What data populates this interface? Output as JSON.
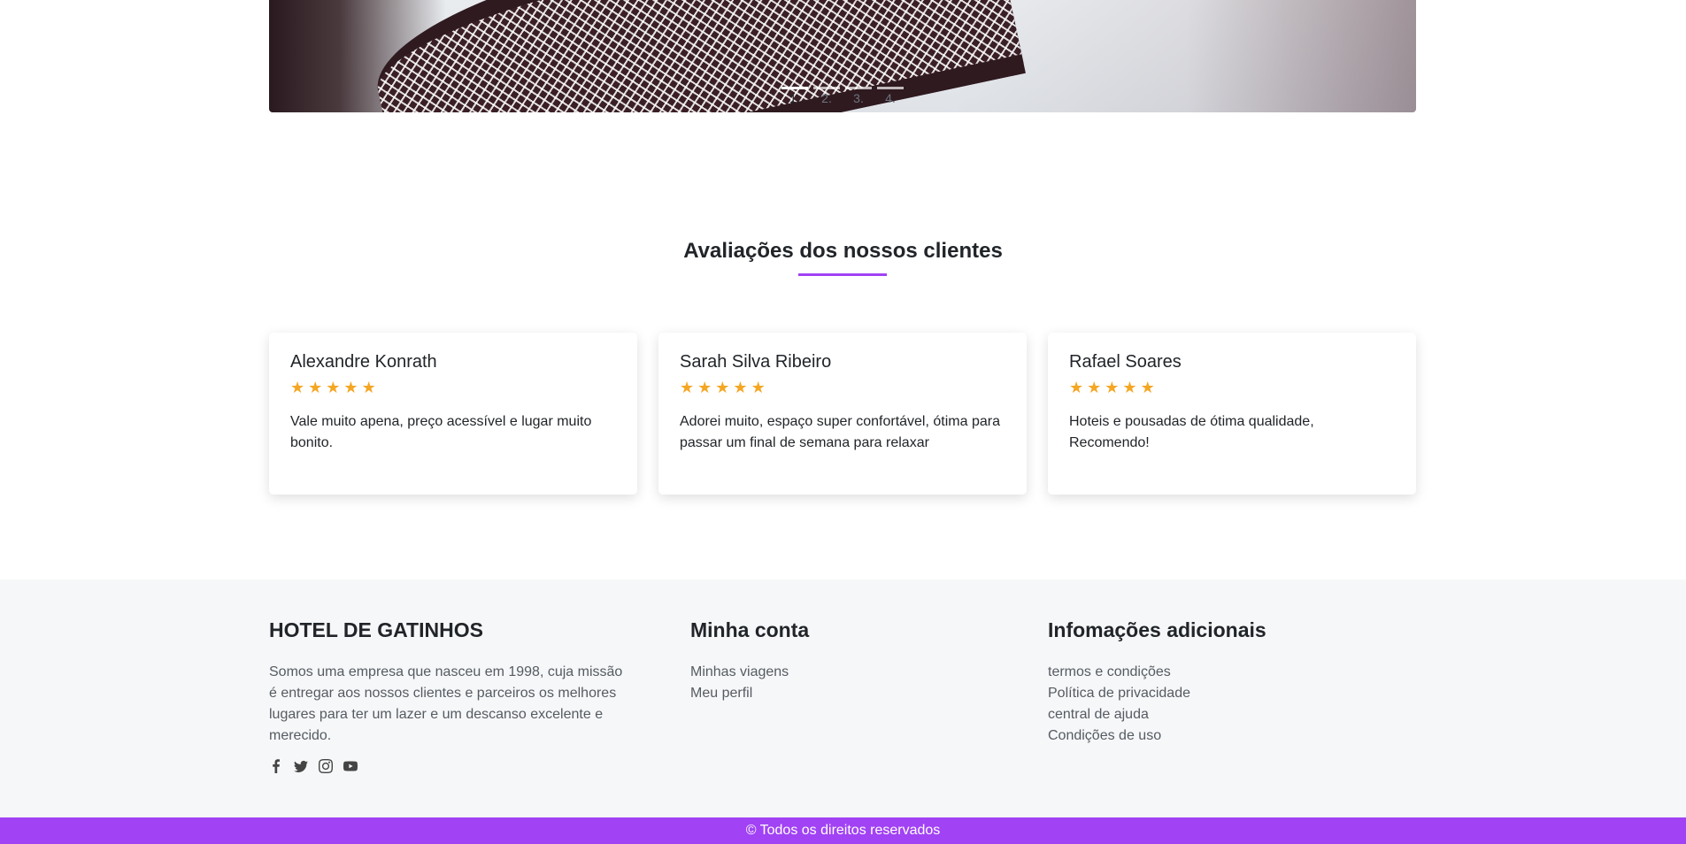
{
  "carousel": {
    "indicators": [
      "1.",
      "2.",
      "3.",
      "4."
    ],
    "active_index": 0
  },
  "reviews": {
    "title": "Avaliações dos nossos clientes",
    "items": [
      {
        "name": "Alexandre Konrath",
        "rating": 5,
        "text": "Vale muito apena, preço acessível e lugar muito bonito."
      },
      {
        "name": "Sarah Silva Ribeiro",
        "rating": 5,
        "text": "Adorei muito, espaço super confortável, ótima para passar um final de semana para relaxar"
      },
      {
        "name": "Rafael Soares",
        "rating": 5,
        "text": "Hoteis e pousadas de ótima qualidade, Recomendo!"
      }
    ]
  },
  "footer": {
    "brand": {
      "title": "HOTEL DE GATINHOS",
      "description": "Somos uma empresa que nasceu em 1998, cuja missão é entregar aos nossos clientes e parceiros os melhores lugares para ter um lazer e um descanso excelente e merecido."
    },
    "socials": [
      "facebook-icon",
      "twitter-icon",
      "instagram-icon",
      "youtube-icon"
    ],
    "account": {
      "title": "Minha conta",
      "links": [
        "Minhas viagens",
        "Meu perfil"
      ]
    },
    "info": {
      "title": "Infomações adicionais",
      "links": [
        "termos e condições",
        "Política de privacidade",
        "central de ajuda",
        "Condições de uso"
      ]
    },
    "copyright": "© Todos os direitos reservados"
  },
  "colors": {
    "accent": "#a142f4",
    "star": "#f5a623",
    "footer_bg": "#f6f7f8"
  }
}
